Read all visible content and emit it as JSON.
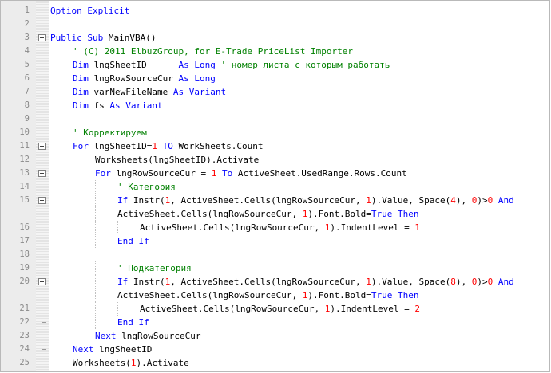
{
  "colors": {
    "keyword": "#0000ff",
    "comment": "#008000",
    "number": "#ff0000",
    "text": "#000000",
    "line_number": "#8a8a8a",
    "gutter": "#ececec"
  },
  "lines": [
    {
      "n": "1",
      "indent": 0,
      "fold": null,
      "tokens": [
        {
          "t": "kw",
          "v": "Option Explicit"
        }
      ]
    },
    {
      "n": "2",
      "indent": 0,
      "fold": null,
      "tokens": []
    },
    {
      "n": "3",
      "indent": 0,
      "fold": "start",
      "tokens": [
        {
          "t": "kw",
          "v": "Public Sub"
        },
        {
          "t": "tx",
          "v": " MainVBA()"
        }
      ]
    },
    {
      "n": "4",
      "indent": 1,
      "fold": "line",
      "tokens": [
        {
          "t": "cm",
          "v": "' (C) 2011 ElbuzGroup, for E-Trade PriceList Importer"
        }
      ]
    },
    {
      "n": "5",
      "indent": 1,
      "fold": "line",
      "tokens": [
        {
          "t": "kw",
          "v": "Dim"
        },
        {
          "t": "tx",
          "v": " lngSheetID      "
        },
        {
          "t": "kw",
          "v": "As Long"
        },
        {
          "t": "tx",
          "v": " "
        },
        {
          "t": "cm",
          "v": "' номер листа с которым работать"
        }
      ]
    },
    {
      "n": "6",
      "indent": 1,
      "fold": "line",
      "tokens": [
        {
          "t": "kw",
          "v": "Dim"
        },
        {
          "t": "tx",
          "v": " lngRowSourceCur "
        },
        {
          "t": "kw",
          "v": "As Long"
        }
      ]
    },
    {
      "n": "7",
      "indent": 1,
      "fold": "line",
      "tokens": [
        {
          "t": "kw",
          "v": "Dim"
        },
        {
          "t": "tx",
          "v": " varNewFileName "
        },
        {
          "t": "kw",
          "v": "As Variant"
        }
      ]
    },
    {
      "n": "8",
      "indent": 1,
      "fold": "line",
      "tokens": [
        {
          "t": "kw",
          "v": "Dim"
        },
        {
          "t": "tx",
          "v": " fs "
        },
        {
          "t": "kw",
          "v": "As Variant"
        }
      ]
    },
    {
      "n": "9",
      "indent": 0,
      "fold": "line",
      "tokens": []
    },
    {
      "n": "10",
      "indent": 1,
      "fold": "line",
      "tokens": [
        {
          "t": "cm",
          "v": "' Корректируем"
        }
      ]
    },
    {
      "n": "11",
      "indent": 1,
      "fold": "start",
      "tokens": [
        {
          "t": "kw",
          "v": "For"
        },
        {
          "t": "tx",
          "v": " lngSheetID="
        },
        {
          "t": "nm",
          "v": "1"
        },
        {
          "t": "tx",
          "v": " "
        },
        {
          "t": "kw",
          "v": "TO"
        },
        {
          "t": "tx",
          "v": " WorkSheets.Count"
        }
      ]
    },
    {
      "n": "12",
      "indent": 2,
      "fold": "line",
      "tokens": [
        {
          "t": "tx",
          "v": "Worksheets(lngSheetID).Activate"
        }
      ]
    },
    {
      "n": "13",
      "indent": 2,
      "fold": "start",
      "tokens": [
        {
          "t": "kw",
          "v": "For"
        },
        {
          "t": "tx",
          "v": " lngRowSourceCur = "
        },
        {
          "t": "nm",
          "v": "1"
        },
        {
          "t": "tx",
          "v": " "
        },
        {
          "t": "kw",
          "v": "To"
        },
        {
          "t": "tx",
          "v": " ActiveSheet.UsedRange.Rows.Count"
        }
      ]
    },
    {
      "n": "14",
      "indent": 3,
      "fold": "line",
      "tokens": [
        {
          "t": "cm",
          "v": "' Категория"
        }
      ]
    },
    {
      "n": "15",
      "indent": 3,
      "fold": "start",
      "tokens": [
        {
          "t": "kw",
          "v": "If"
        },
        {
          "t": "tx",
          "v": " Instr("
        },
        {
          "t": "nm",
          "v": "1"
        },
        {
          "t": "tx",
          "v": ", ActiveSheet.Cells(lngRowSourceCur, "
        },
        {
          "t": "nm",
          "v": "1"
        },
        {
          "t": "tx",
          "v": ").Value, Space("
        },
        {
          "t": "nm",
          "v": "4"
        },
        {
          "t": "tx",
          "v": "), "
        },
        {
          "t": "nm",
          "v": "0"
        },
        {
          "t": "tx",
          "v": ")>"
        },
        {
          "t": "nm",
          "v": "0"
        },
        {
          "t": "tx",
          "v": " "
        },
        {
          "t": "kw",
          "v": "And"
        }
      ]
    },
    {
      "n": "",
      "indent": 3,
      "fold": "line",
      "tokens": [
        {
          "t": "tx",
          "v": "ActiveSheet.Cells(lngRowSourceCur, "
        },
        {
          "t": "nm",
          "v": "1"
        },
        {
          "t": "tx",
          "v": ").Font.Bold="
        },
        {
          "t": "kw",
          "v": "True"
        },
        {
          "t": "tx",
          "v": " "
        },
        {
          "t": "kw",
          "v": "Then"
        }
      ]
    },
    {
      "n": "16",
      "indent": 4,
      "fold": "line",
      "tokens": [
        {
          "t": "tx",
          "v": "ActiveSheet.Cells(lngRowSourceCur, "
        },
        {
          "t": "nm",
          "v": "1"
        },
        {
          "t": "tx",
          "v": ").IndentLevel = "
        },
        {
          "t": "nm",
          "v": "1"
        }
      ]
    },
    {
      "n": "17",
      "indent": 3,
      "fold": "end",
      "tokens": [
        {
          "t": "kw",
          "v": "End If"
        }
      ]
    },
    {
      "n": "18",
      "indent": 0,
      "fold": "line",
      "tokens": []
    },
    {
      "n": "19",
      "indent": 3,
      "fold": "line",
      "tokens": [
        {
          "t": "cm",
          "v": "' Подкатегория"
        }
      ]
    },
    {
      "n": "20",
      "indent": 3,
      "fold": "start",
      "tokens": [
        {
          "t": "kw",
          "v": "If"
        },
        {
          "t": "tx",
          "v": " Instr("
        },
        {
          "t": "nm",
          "v": "1"
        },
        {
          "t": "tx",
          "v": ", ActiveSheet.Cells(lngRowSourceCur, "
        },
        {
          "t": "nm",
          "v": "1"
        },
        {
          "t": "tx",
          "v": ").Value, Space("
        },
        {
          "t": "nm",
          "v": "8"
        },
        {
          "t": "tx",
          "v": "), "
        },
        {
          "t": "nm",
          "v": "0"
        },
        {
          "t": "tx",
          "v": ")>"
        },
        {
          "t": "nm",
          "v": "0"
        },
        {
          "t": "tx",
          "v": " "
        },
        {
          "t": "kw",
          "v": "And"
        }
      ]
    },
    {
      "n": "",
      "indent": 3,
      "fold": "line",
      "tokens": [
        {
          "t": "tx",
          "v": "ActiveSheet.Cells(lngRowSourceCur, "
        },
        {
          "t": "nm",
          "v": "1"
        },
        {
          "t": "tx",
          "v": ").Font.Bold="
        },
        {
          "t": "kw",
          "v": "True"
        },
        {
          "t": "tx",
          "v": " "
        },
        {
          "t": "kw",
          "v": "Then"
        }
      ]
    },
    {
      "n": "21",
      "indent": 4,
      "fold": "line",
      "tokens": [
        {
          "t": "tx",
          "v": "ActiveSheet.Cells(lngRowSourceCur, "
        },
        {
          "t": "nm",
          "v": "1"
        },
        {
          "t": "tx",
          "v": ").IndentLevel = "
        },
        {
          "t": "nm",
          "v": "2"
        }
      ]
    },
    {
      "n": "22",
      "indent": 3,
      "fold": "end",
      "tokens": [
        {
          "t": "kw",
          "v": "End If"
        }
      ]
    },
    {
      "n": "23",
      "indent": 2,
      "fold": "end",
      "tokens": [
        {
          "t": "kw",
          "v": "Next"
        },
        {
          "t": "tx",
          "v": " lngRowSourceCur"
        }
      ]
    },
    {
      "n": "24",
      "indent": 1,
      "fold": "end",
      "tokens": [
        {
          "t": "kw",
          "v": "Next"
        },
        {
          "t": "tx",
          "v": " lngSheetID"
        }
      ]
    },
    {
      "n": "25",
      "indent": 1,
      "fold": "line",
      "tokens": [
        {
          "t": "tx",
          "v": "Worksheets("
        },
        {
          "t": "nm",
          "v": "1"
        },
        {
          "t": "tx",
          "v": ").Activate"
        }
      ]
    }
  ]
}
